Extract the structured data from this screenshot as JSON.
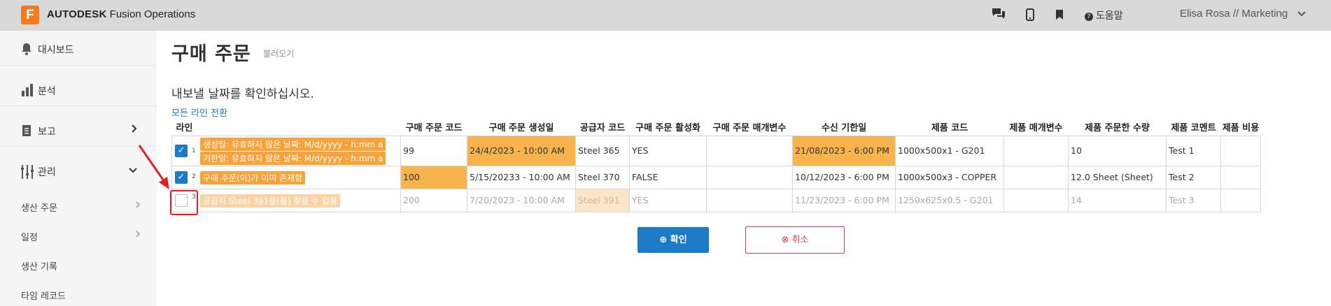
{
  "header": {
    "logo_letter": "F",
    "brand_bold": "AUTODESK",
    "brand_rest": "Fusion Operations",
    "help_label": "도움말",
    "user_label": "Elisa Rosa // Marketing",
    "icons": [
      "chat-icon",
      "mobile-icon",
      "bookmark-icon",
      "help-icon",
      "chevron-down-icon"
    ]
  },
  "sidebar": {
    "items": [
      {
        "label": "대시보드",
        "icon": "bell-icon"
      },
      {
        "label": "분석",
        "icon": "bar-chart-icon"
      },
      {
        "label": "보고",
        "icon": "report-icon"
      },
      {
        "label": "관리",
        "icon": "manage-icon"
      }
    ],
    "sub_items": [
      {
        "label": "생산 주문"
      },
      {
        "label": "일정"
      },
      {
        "label": "생산 기록"
      },
      {
        "label": "타임 레코드"
      }
    ]
  },
  "page": {
    "title": "구매 주문",
    "subtitle": "불러오기",
    "instruction": "내보낼 날짜를 확인하십시오.",
    "toggle_all": "모든 라인 전환"
  },
  "table": {
    "headers": [
      "라인",
      "구매 주문 코드",
      "구매 주문 생성일",
      "공급자 코드",
      "구매 주문 활성화",
      "구매 주문 매개변수",
      "수신 기한일",
      "제품 코드",
      "제품 매개변수",
      "제품 주문한 수량",
      "제품 코멘트",
      "제품 비용"
    ],
    "rows": [
      {
        "num": "1",
        "checked": true,
        "errors": [
          "생성일: 유효하지 않은 날짜: M/d/yyyy - h:mm a",
          "기한일: 유효하지 않은 날짜: M/d/yyyy - h:mm a"
        ],
        "cells": [
          "99",
          "24/4/2023 - 10:00 AM",
          "Steel 365",
          "YES",
          "",
          "21/08/2023 - 6:00 PM",
          "1000x500x1 - G201",
          "",
          "10",
          "Test 1",
          ""
        ]
      },
      {
        "num": "2",
        "checked": true,
        "errors": [
          "구매 주문(이)가 이미 존재함"
        ],
        "cells": [
          "100",
          "5/15/20233 - 10:00 AM",
          "Steel 370",
          "FALSE",
          "",
          "10/12/2023 - 6:00 PM",
          "1000x500x3 - COPPER",
          "",
          "12.0 Sheet  (Sheet)",
          "Test 2",
          ""
        ]
      },
      {
        "num": "3",
        "checked": false,
        "errors": [
          "공급자 Steel 391을(를) 찾을 수 없음"
        ],
        "cells": [
          "200",
          "7/20/2023 - 10:00 AM",
          "Steel 391",
          "YES",
          "",
          "11/23/2023 - 6:00 PM",
          "1250x625x0.5 - G201",
          "",
          "14",
          "Test 3",
          ""
        ]
      }
    ]
  },
  "buttons": {
    "ok_label": "확인",
    "cancel_label": "취소"
  },
  "colors": {
    "accent": "#1d7ac7",
    "error_highlight": "#f8b44c",
    "cancel": "#d8404a",
    "annotation": "#e02020"
  }
}
